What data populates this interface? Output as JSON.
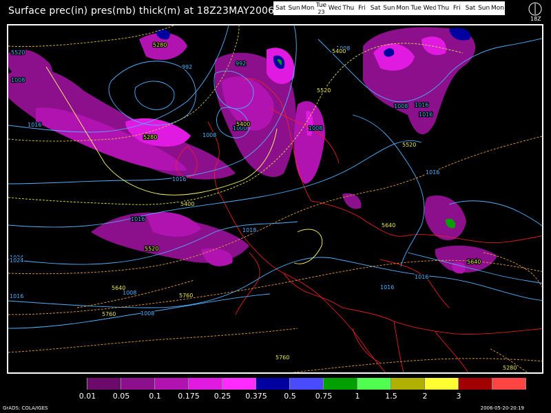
{
  "title": "Surface prec(in) pres(mb) thick(m) at 18Z23MAY2006",
  "days": [
    {
      "label": "Sat"
    },
    {
      "label": "Sun"
    },
    {
      "label": "Mon"
    },
    {
      "label": "Tue",
      "date": "23",
      "current": true
    },
    {
      "label": "Wed"
    },
    {
      "label": "Thu"
    },
    {
      "label": "Fri"
    },
    {
      "label": "Sat"
    },
    {
      "label": "Sun"
    },
    {
      "label": "Mon"
    },
    {
      "label": "Tue"
    },
    {
      "label": "Wed"
    },
    {
      "label": "Thu"
    },
    {
      "label": "Fri"
    },
    {
      "label": "Sat"
    },
    {
      "label": "Sun"
    },
    {
      "label": "Mon"
    }
  ],
  "clock_label": "18Z",
  "legend": {
    "colors": [
      "#000000",
      "#6b0a6b",
      "#8c0f8c",
      "#b013b0",
      "#e01ae0",
      "#ff2bff",
      "#0000a0",
      "#4a4aff",
      "#00a000",
      "#50ff50",
      "#b0b000",
      "#ffff33",
      "#a00000",
      "#ff4444"
    ],
    "labels": [
      "0.01",
      "0.05",
      "0.1",
      "0.175",
      "0.25",
      "0.375",
      "0.5",
      "0.75",
      "1",
      "1.5",
      "2",
      "3"
    ]
  },
  "map": {
    "pressure_labels": [
      "5520",
      "1008",
      "1016",
      "992",
      "992",
      "1000",
      "1008",
      "1008",
      "1016",
      "1018",
      "1016",
      "1024",
      "1016",
      "1024",
      "1016",
      "1008",
      "1016",
      "1008",
      "1016",
      "1016",
      "1008",
      "1016",
      "1008"
    ],
    "thickness_labels": [
      "5280",
      "5280",
      "5400",
      "5400",
      "5400",
      "5520",
      "5520",
      "5520",
      "5640",
      "5640",
      "5640",
      "5760",
      "5760",
      "5760",
      "5280"
    ],
    "colors": {
      "pressure": "#4fb3ff",
      "thickness": "#e8e84a",
      "coast": "#ff2020"
    }
  },
  "footer_left": "GrADS: COLA/IGES",
  "footer_right": "2006-05-20-20:19"
}
